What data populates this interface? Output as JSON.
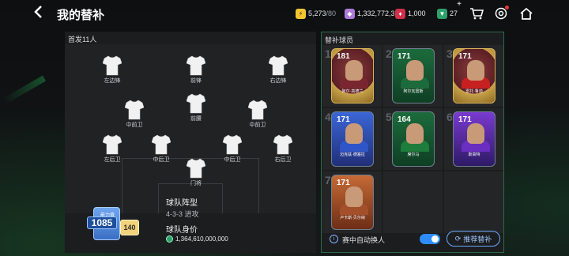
{
  "header": {
    "title": "我的替补",
    "currencies": [
      {
        "value": "5,273",
        "sub": "/80",
        "color": "#f3c530",
        "icon": "energy-icon"
      },
      {
        "value": "1,332,772,311",
        "sub": "",
        "color": "#b07ad8",
        "icon": "fc-coin-icon"
      },
      {
        "value": "1,000",
        "sub": "",
        "color": "#d0304a",
        "icon": "gem-icon"
      },
      {
        "value": "27",
        "sub": "",
        "color": "#2ea06b",
        "icon": "token-icon"
      }
    ]
  },
  "starting": {
    "title": "首发11人",
    "positions": [
      {
        "label": "左边锋"
      },
      {
        "label": "前锋"
      },
      {
        "label": "右边锋"
      },
      {
        "label": "中前卫"
      },
      {
        "label": "前腰"
      },
      {
        "label": "中前卫"
      },
      {
        "label": "左后卫"
      },
      {
        "label": "中后卫"
      },
      {
        "label": "中后卫"
      },
      {
        "label": "右后卫"
      },
      {
        "label": "门将"
      }
    ],
    "rating_label": "能力值",
    "rating_value": "1085",
    "rating_sub": "140",
    "formation_label": "球队阵型",
    "formation": "4-3-3 进攻",
    "value_label": "球队身价",
    "team_value": "1,364,610,000,000"
  },
  "subs": {
    "title": "替补球员",
    "cards": [
      {
        "num": "1",
        "rating": "181",
        "name": "阿尔·高德兰",
        "style": "gold-round",
        "color": "#7a2630"
      },
      {
        "num": "2",
        "rating": "171",
        "name": "阿尔瓦雷斯",
        "style": "green",
        "color": "#1d6b3c"
      },
      {
        "num": "3",
        "rating": "171",
        "name": "雷托·鲁迪",
        "style": "gold-round",
        "color": "#c62020"
      },
      {
        "num": "4",
        "rating": "171",
        "name": "迈克兹·德塞拉",
        "style": "blue",
        "color": "#2f55c9"
      },
      {
        "num": "5",
        "rating": "164",
        "name": "席尔马",
        "style": "green",
        "color": "#1e7d3c"
      },
      {
        "num": "6",
        "rating": "171",
        "name": "斯高特",
        "style": "purple",
        "color": "#6a2ec0"
      },
      {
        "num": "7",
        "rating": "171",
        "name": "卢卡斯·贝尔纳",
        "style": "bronze",
        "color": "#a3502a"
      }
    ],
    "auto_label": "赛中自动换人",
    "auto_enabled": true,
    "recommend_label": "推荐替补"
  }
}
